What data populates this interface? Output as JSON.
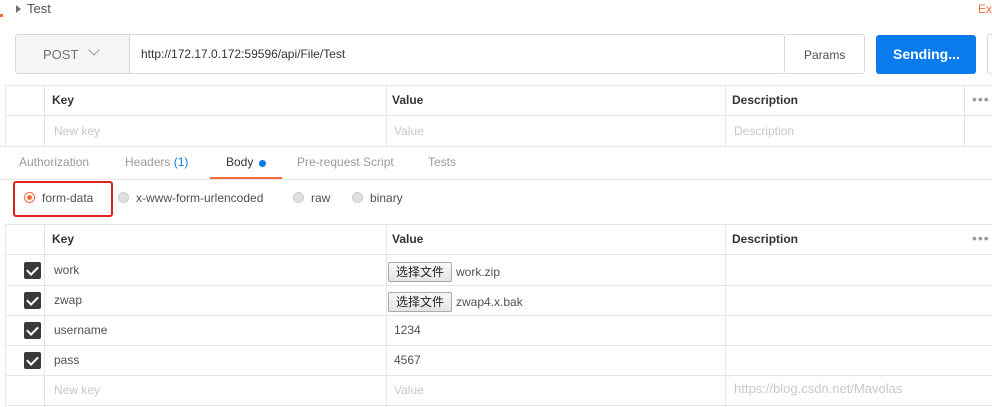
{
  "header": {
    "title": "Test",
    "right_label": "Ex"
  },
  "request": {
    "method": "POST",
    "url": "http://172.17.0.172:59596/api/File/Test",
    "params_label": "Params",
    "send_label": "Sending..."
  },
  "params_table": {
    "columns": [
      "Key",
      "Value",
      "Description"
    ],
    "placeholder_row": {
      "key": "New key",
      "value": "Value",
      "description": "Description"
    }
  },
  "tabs": [
    {
      "label": "Authorization"
    },
    {
      "label": "Headers",
      "count": "(1)"
    },
    {
      "label": "Body"
    },
    {
      "label": "Pre-request Script"
    },
    {
      "label": "Tests"
    }
  ],
  "body_types": [
    {
      "label": "form-data",
      "selected": true
    },
    {
      "label": "x-www-form-urlencoded",
      "selected": false
    },
    {
      "label": "raw",
      "selected": false
    },
    {
      "label": "binary",
      "selected": false
    }
  ],
  "form_table": {
    "columns": [
      "Key",
      "Value",
      "Description"
    ],
    "rows": [
      {
        "key": "work",
        "file_button": "选择文件",
        "value": "work.zip",
        "checked": true
      },
      {
        "key": "zwap",
        "file_button": "选择文件",
        "value": "zwap4.x.bak",
        "checked": true
      },
      {
        "key": "username",
        "value": "1234",
        "checked": true
      },
      {
        "key": "pass",
        "value": "4567",
        "checked": true
      }
    ],
    "placeholder_row": {
      "key": "New key",
      "value": "Value",
      "description": "Description"
    }
  },
  "watermark": "https://blog.csdn.net/Mavolas",
  "colors": {
    "accent": "#f26b3a",
    "primary": "#097bed",
    "highlight_box": "#e02020"
  }
}
